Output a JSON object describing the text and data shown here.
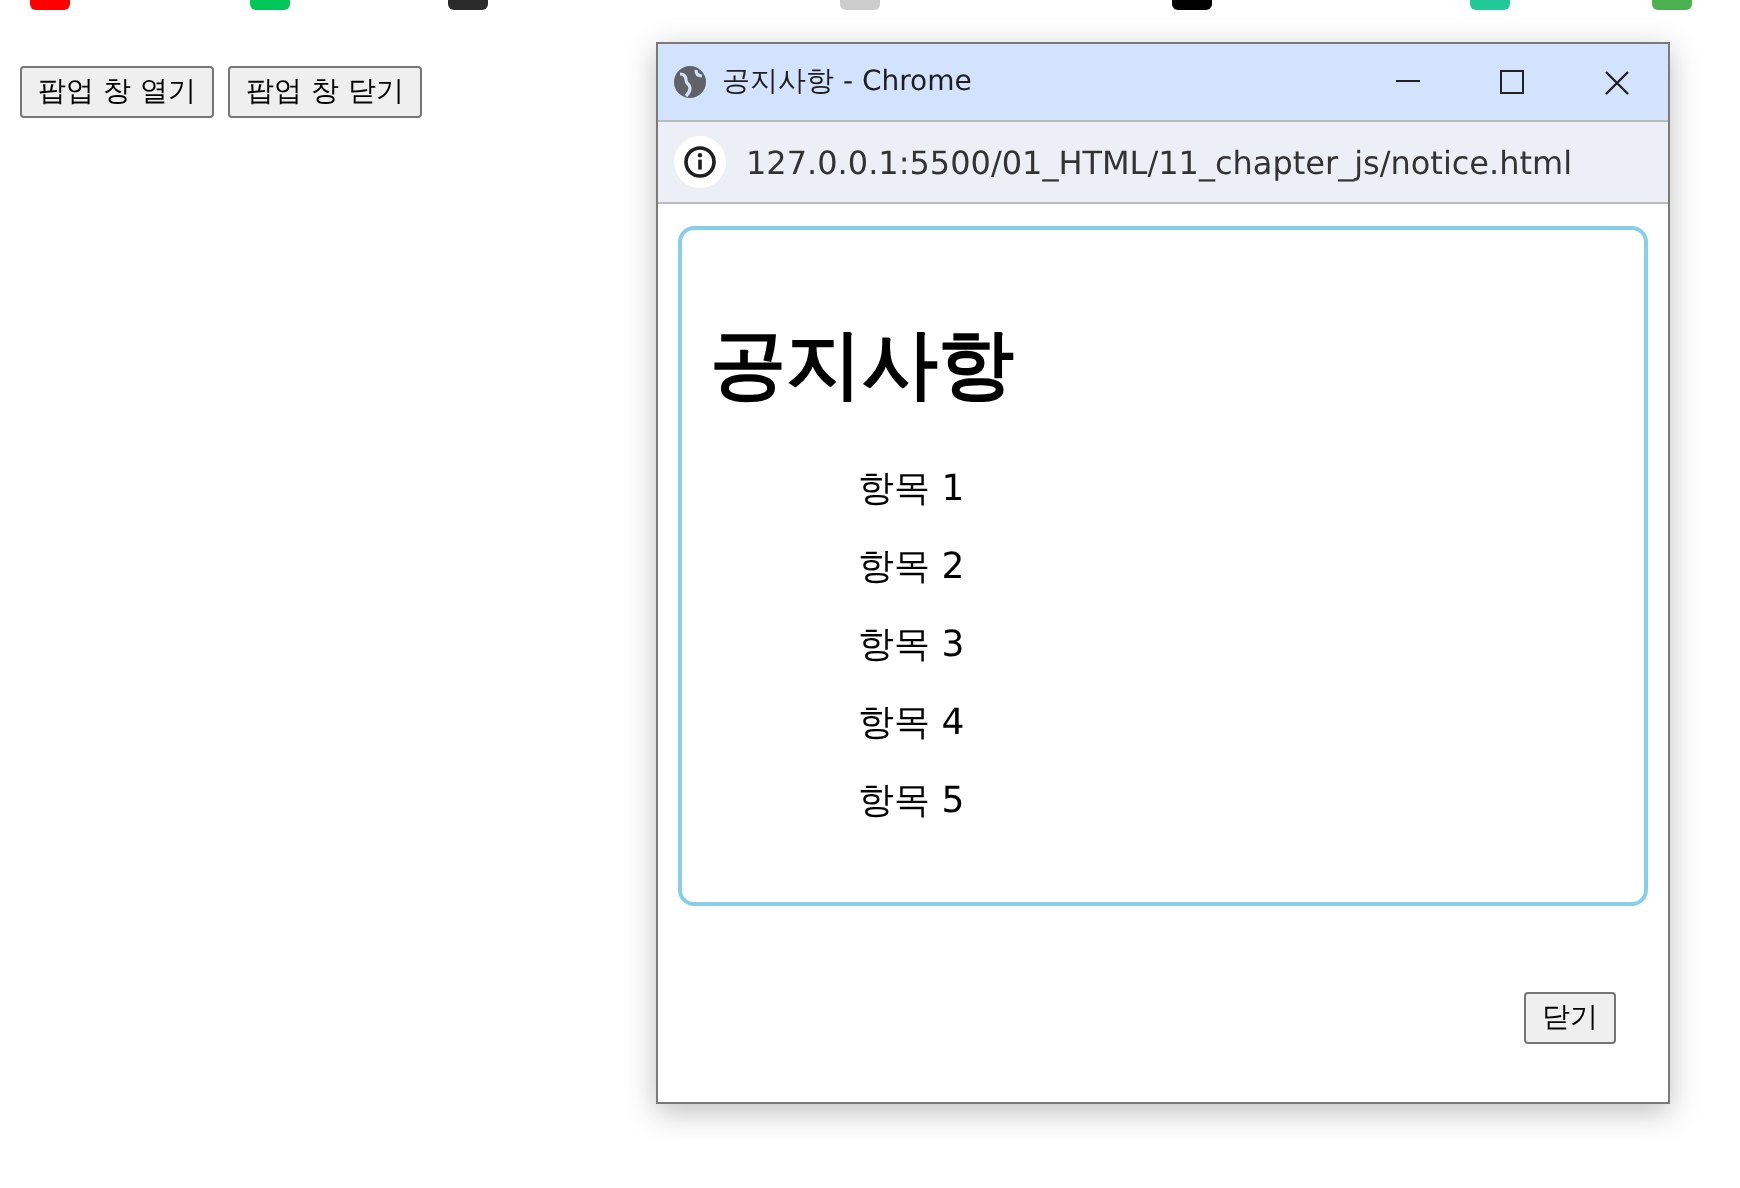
{
  "page": {
    "buttons": [
      "팝업 창 열기",
      "팝업 창 닫기"
    ]
  },
  "popup": {
    "title": "공지사항 - Chrome",
    "url": "127.0.0.1:5500/01_HTML/11_chapter_js/notice.html",
    "heading": "공지사항",
    "items": [
      "항목 1",
      "항목 2",
      "항목 3",
      "항목 4",
      "항목 5"
    ],
    "close_button": "닫기"
  }
}
